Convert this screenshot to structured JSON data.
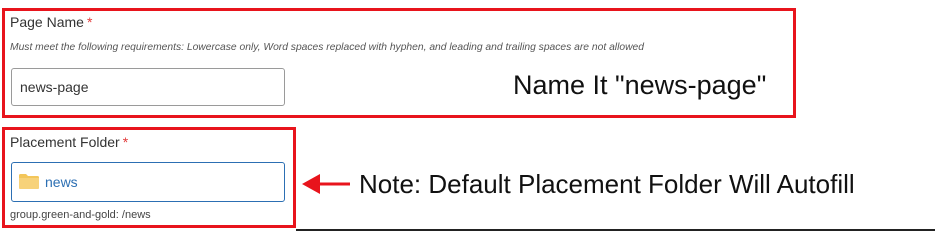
{
  "page_name": {
    "label": "Page Name",
    "required_mark": "*",
    "help": "Must meet the following requirements: Lowercase only, Word spaces replaced with hyphen, and leading and trailing spaces are not allowed",
    "value": "news-page",
    "annotation": "Name It \"news-page\""
  },
  "placement_folder": {
    "label": "Placement Folder",
    "required_mark": "*",
    "value": "news",
    "icon": "folder-icon",
    "path": "group.green-and-gold: /news",
    "note": "Note: Default Placement Folder Will Autofill"
  },
  "colors": {
    "highlight_border": "#e8141c",
    "required": "#e23b3b",
    "folder_text": "#2c6fb3",
    "folder_icon": "#f3c65a"
  }
}
